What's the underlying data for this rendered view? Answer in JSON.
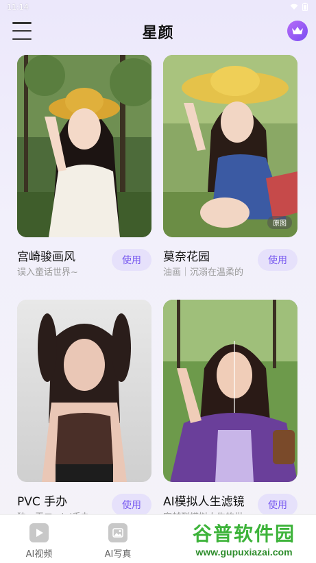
{
  "status_bar": {
    "time": "11:14"
  },
  "header": {
    "title": "星颜"
  },
  "cards": [
    {
      "name": "宫崎骏画风",
      "desc": "误入童话世界~",
      "use_label": "使用"
    },
    {
      "name": "莫奈花园",
      "desc": "油画｜沉溺在温柔的",
      "use_label": "使用",
      "badge": "原图"
    },
    {
      "name": "PVC 手办",
      "desc": "独一无二mini手办",
      "use_label": "使用"
    },
    {
      "name": "AI模拟人生滤镜",
      "desc": "穿越到模拟人生的世",
      "use_label": "使用"
    }
  ],
  "bottom_nav": [
    {
      "label": "AI视频",
      "icon": "play-icon"
    },
    {
      "label": "AI写真",
      "icon": "image-icon"
    }
  ],
  "watermark": {
    "cn": "谷普软件园",
    "url": "www.gupuxiazai.com"
  },
  "colors": {
    "accent": "#7a5cf0",
    "button_bg": "#e6e1fb",
    "vip": "#9b5cf5"
  }
}
